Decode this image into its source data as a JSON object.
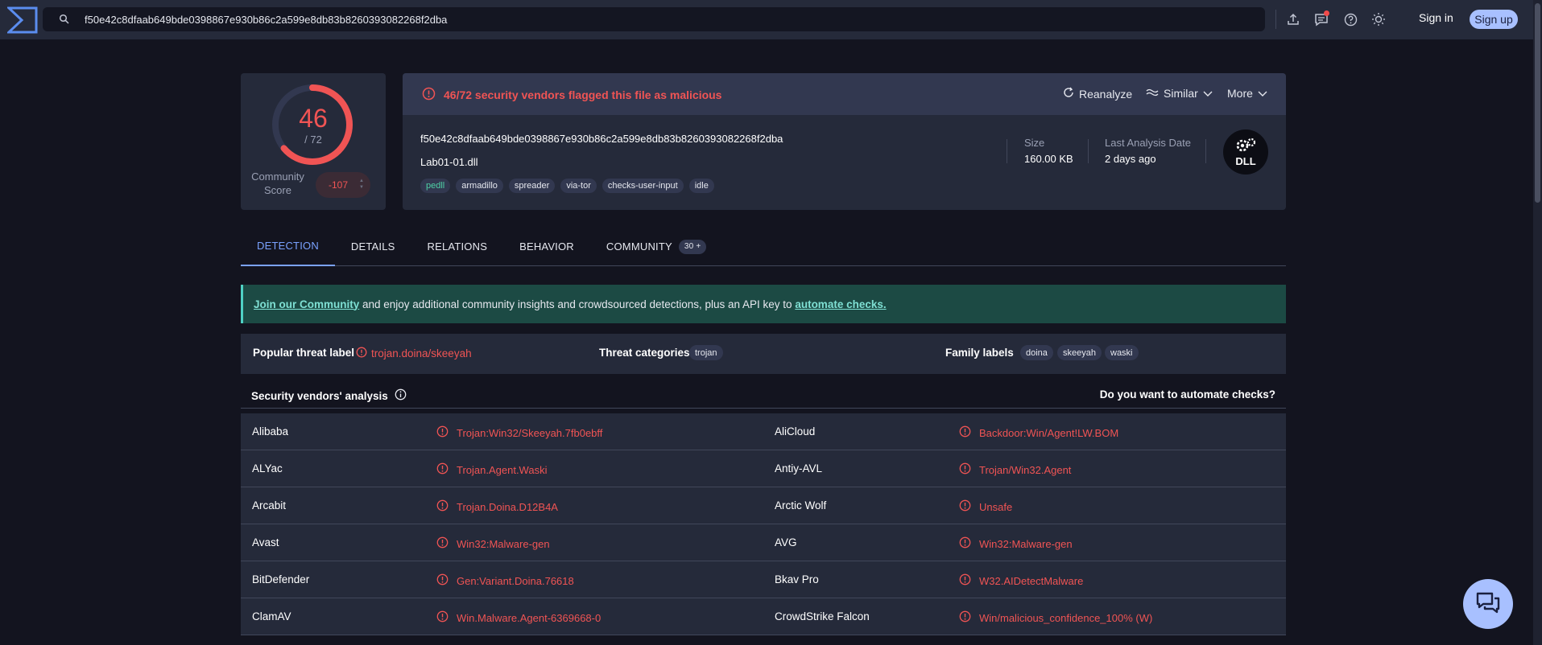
{
  "search": {
    "value": "f50e42c8dfaab649bde0398867e930b86c2a599e8db83b8260393082268f2dba"
  },
  "header": {
    "signin_label": "Sign in",
    "signup_label": "Sign up"
  },
  "score": {
    "detections": "46",
    "total": "/ 72",
    "fraction_flagged": 0.639,
    "community_label": "Community Score",
    "community_value": "-107"
  },
  "alert": {
    "text": "46/72 security vendors flagged this file as malicious"
  },
  "actions": {
    "reanalyze": "Reanalyze",
    "similar": "Similar",
    "more": "More"
  },
  "file": {
    "hash": "f50e42c8dfaab649bde0398867e930b86c2a599e8db83b8260393082268f2dba",
    "name": "Lab01-01.dll",
    "tags": [
      "pedll",
      "armadillo",
      "spreader",
      "via-tor",
      "checks-user-input",
      "idle"
    ],
    "size_label": "Size",
    "size_value": "160.00 KB",
    "date_label": "Last Analysis Date",
    "date_value": "2 days ago",
    "type_icon_label": "DLL"
  },
  "tabs": [
    {
      "label": "DETECTION",
      "active": true
    },
    {
      "label": "DETAILS"
    },
    {
      "label": "RELATIONS"
    },
    {
      "label": "BEHAVIOR"
    },
    {
      "label": "COMMUNITY",
      "count": "30 +"
    }
  ],
  "banner": {
    "link1": "Join our Community",
    "middle": " and enjoy additional community insights and crowdsourced detections, plus an API key to ",
    "link2": "automate checks."
  },
  "threat": {
    "popular_label": "Popular threat label",
    "popular_value": "trojan.doina/skeeyah",
    "categories_label": "Threat categories",
    "categories": [
      "trojan"
    ],
    "family_label": "Family labels",
    "families": [
      "doina",
      "skeeyah",
      "waski"
    ]
  },
  "vendors": {
    "title": "Security vendors' analysis",
    "cta": "Do you want to automate checks?",
    "rows": [
      {
        "left_name": "Alibaba",
        "left_result": "Trojan:Win32/Skeeyah.7fb0ebff",
        "right_name": "AliCloud",
        "right_result": "Backdoor:Win/Agent!LW.BOM"
      },
      {
        "left_name": "ALYac",
        "left_result": "Trojan.Agent.Waski",
        "right_name": "Antiy-AVL",
        "right_result": "Trojan/Win32.Agent"
      },
      {
        "left_name": "Arcabit",
        "left_result": "Trojan.Doina.D12B4A",
        "right_name": "Arctic Wolf",
        "right_result": "Unsafe"
      },
      {
        "left_name": "Avast",
        "left_result": "Win32:Malware-gen",
        "right_name": "AVG",
        "right_result": "Win32:Malware-gen"
      },
      {
        "left_name": "BitDefender",
        "left_result": "Gen:Variant.Doina.76618",
        "right_name": "Bkav Pro",
        "right_result": "W32.AIDetectMalware"
      },
      {
        "left_name": "ClamAV",
        "left_result": "Win.Malware.Agent-6369668-0",
        "right_name": "CrowdStrike Falcon",
        "right_result": "Win/malicious_confidence_100% (W)"
      }
    ]
  },
  "colors": {
    "background": "#13141f",
    "card": "#252a3a",
    "malicious": "#f05454",
    "accent": "#7aa2ff",
    "banner": "#1c4a44"
  },
  "icons": [
    "virustotal-logo",
    "search-icon",
    "upload-icon",
    "chat-icon",
    "help-icon",
    "theme-icon",
    "reanalyze-icon",
    "similar-icon",
    "chevron-down-icon",
    "alert-icon",
    "info-icon",
    "gears-icon",
    "chat-bubble-icon"
  ]
}
